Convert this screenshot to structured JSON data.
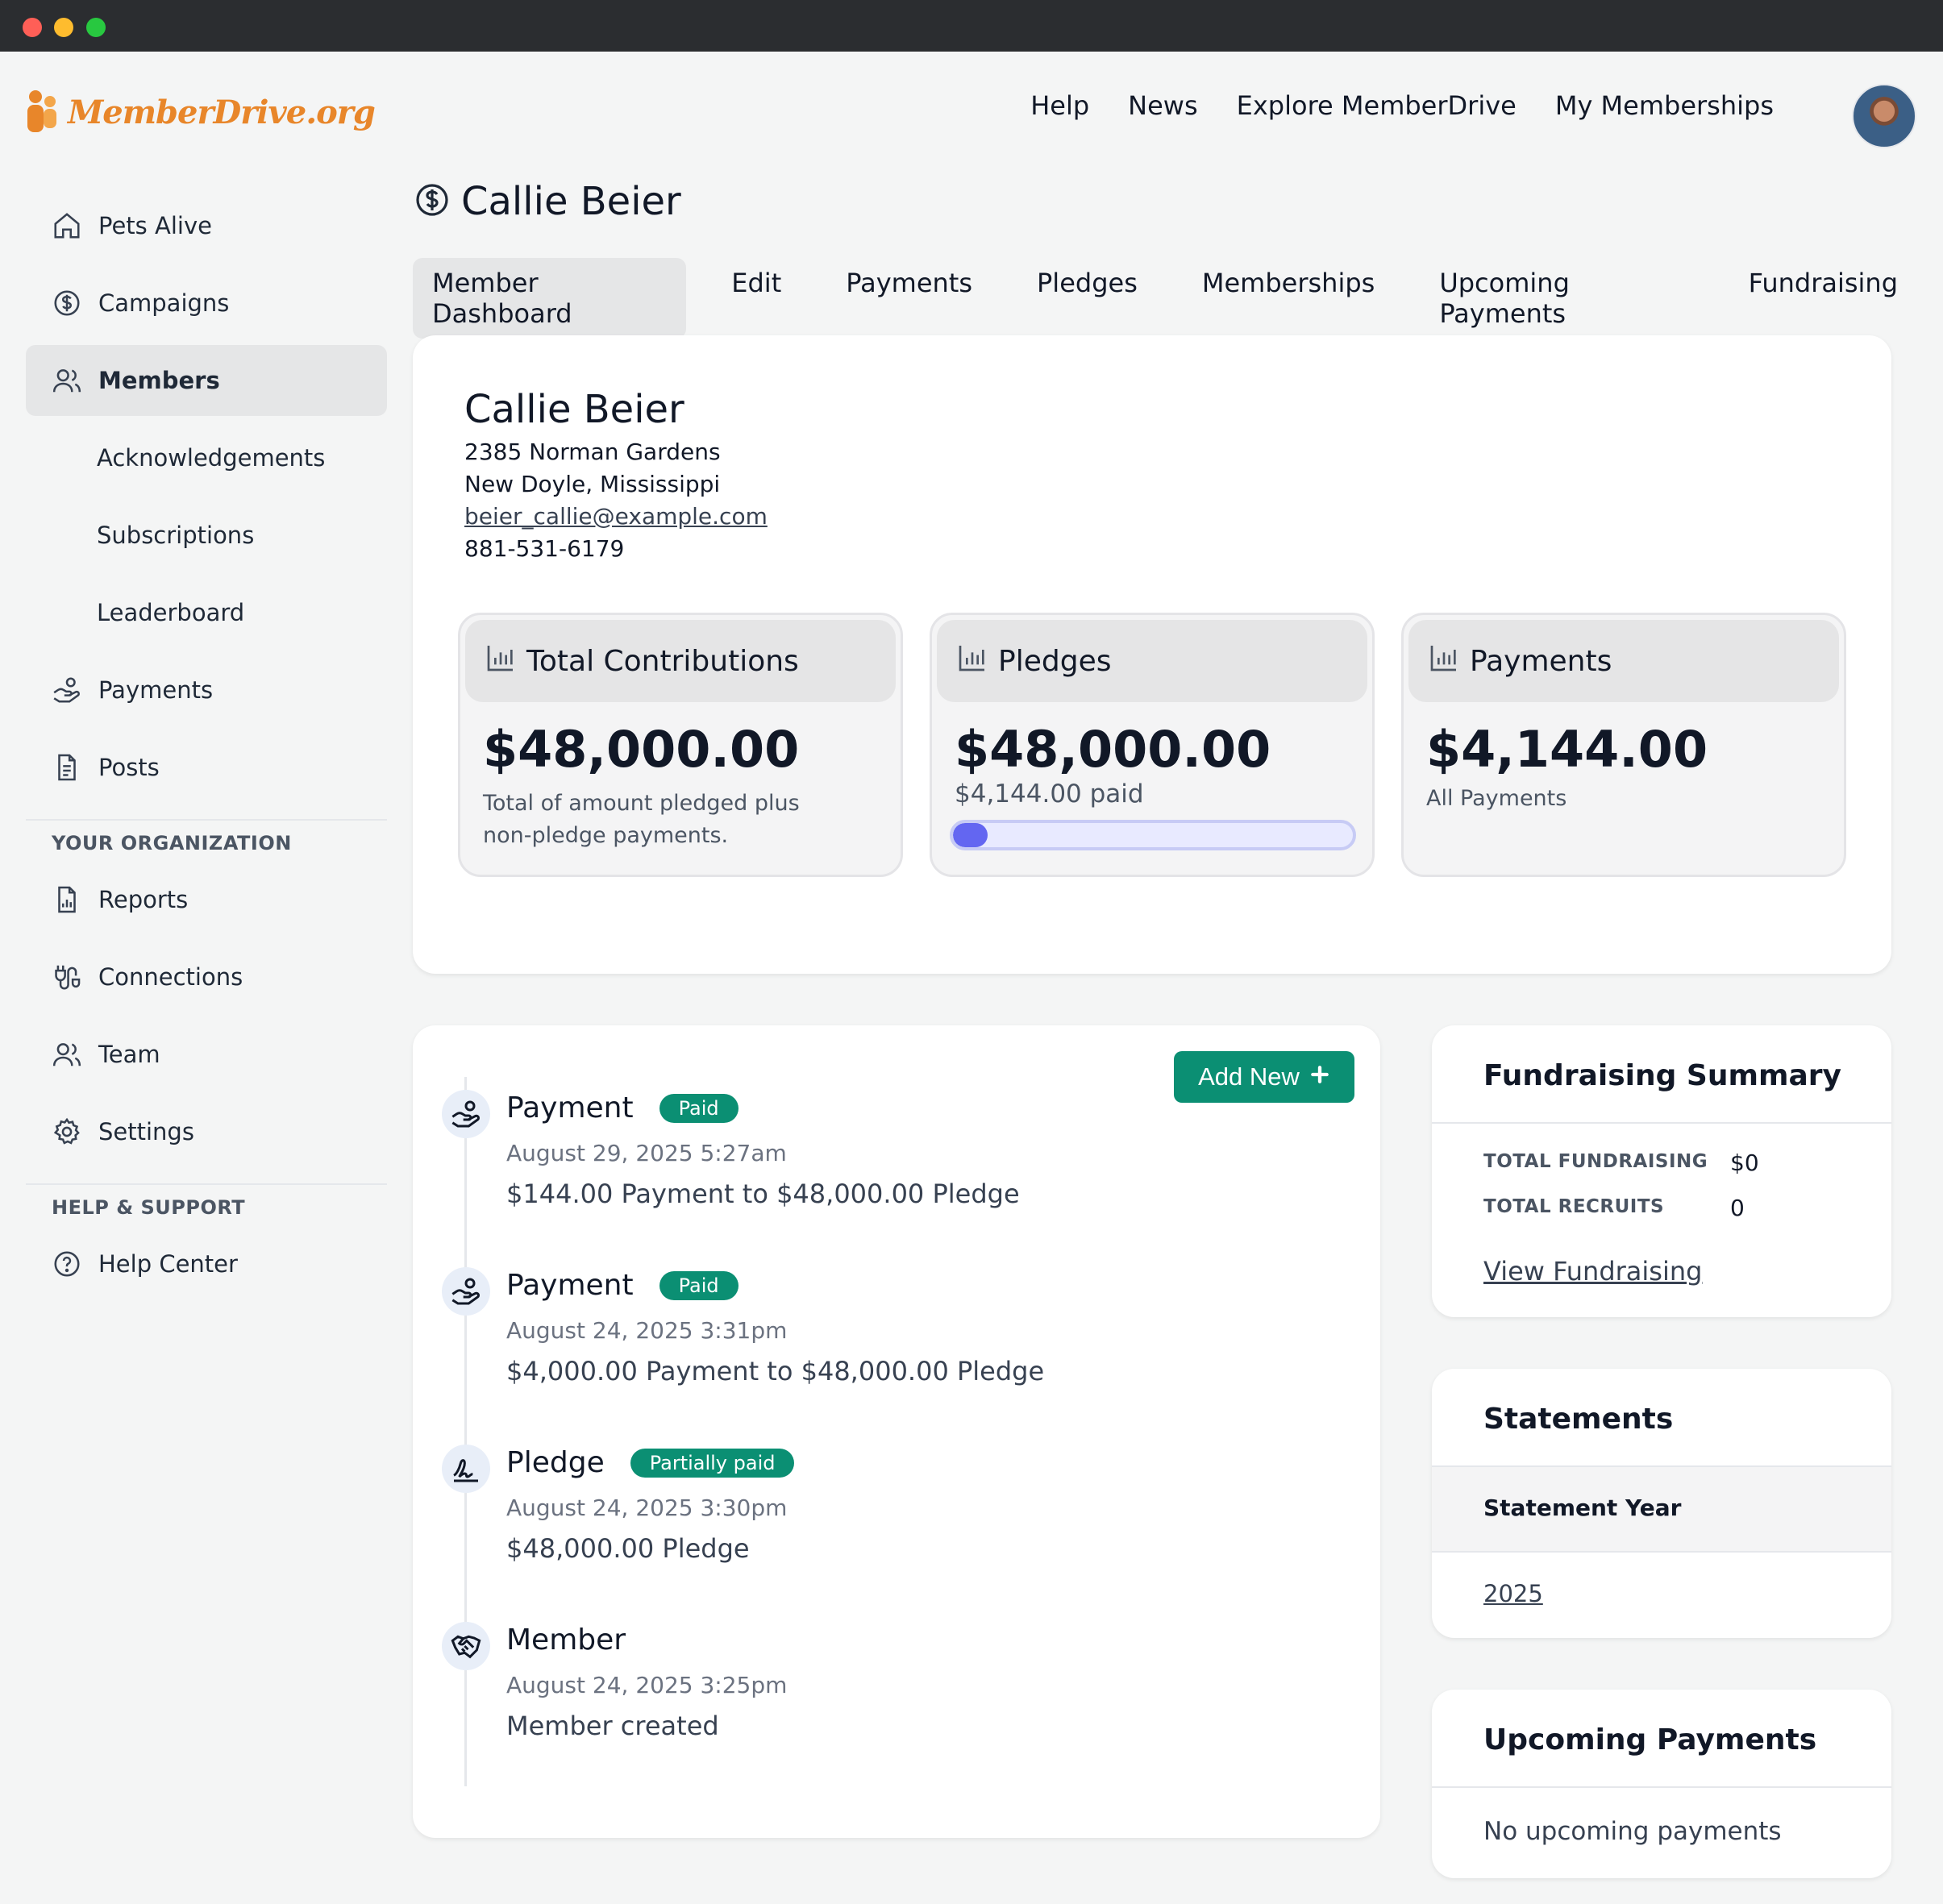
{
  "app": {
    "logo_text": "MemberDrive.org"
  },
  "topnav": [
    "Help",
    "News",
    "Explore MemberDrive",
    "My Memberships"
  ],
  "sidebar": {
    "items": [
      {
        "label": "Pets Alive",
        "icon": "home-icon"
      },
      {
        "label": "Campaigns",
        "icon": "dollar-circle-icon"
      },
      {
        "label": "Members",
        "icon": "users-icon",
        "active": true
      },
      {
        "label": "Acknowledgements",
        "sub": true
      },
      {
        "label": "Subscriptions",
        "sub": true
      },
      {
        "label": "Leaderboard",
        "sub": true
      },
      {
        "label": "Payments",
        "icon": "hand-coins-icon"
      },
      {
        "label": "Posts",
        "icon": "document-icon"
      }
    ],
    "org_heading": "YOUR ORGANIZATION",
    "org_items": [
      {
        "label": "Reports",
        "icon": "report-icon"
      },
      {
        "label": "Connections",
        "icon": "plug-icon"
      },
      {
        "label": "Team",
        "icon": "users-icon"
      },
      {
        "label": "Settings",
        "icon": "gear-icon"
      }
    ],
    "help_heading": "HELP & SUPPORT",
    "help_items": [
      {
        "label": "Help Center",
        "icon": "question-circle-icon"
      }
    ]
  },
  "page": {
    "title": "Callie Beier",
    "tabs": [
      "Member Dashboard",
      "Edit",
      "Payments",
      "Pledges",
      "Memberships",
      "Upcoming Payments",
      "Fundraising"
    ],
    "active_tab": "Member Dashboard"
  },
  "member": {
    "name": "Callie Beier",
    "address1": "2385 Norman Gardens",
    "address2": "New Doyle, Mississippi",
    "email": "beier_callie@example.com",
    "phone": "881-531-6179"
  },
  "stats": {
    "contributions": {
      "label": "Total Contributions",
      "value": "$48,000.00",
      "desc": "Total of amount pledged plus non-pledge payments."
    },
    "pledges": {
      "label": "Pledges",
      "value": "$48,000.00",
      "sub": "$4,144.00 paid",
      "progress": 0.0863
    },
    "payments": {
      "label": "Payments",
      "value": "$4,144.00",
      "sub": "All Payments"
    }
  },
  "timeline": {
    "add_new_label": "Add New",
    "items": [
      {
        "type": "Payment",
        "badge": "Paid",
        "date": "August 29, 2025 5:27am",
        "desc": "$144.00 Payment to $48,000.00 Pledge",
        "icon": "hand-coins-icon"
      },
      {
        "type": "Payment",
        "badge": "Paid",
        "date": "August 24, 2025 3:31pm",
        "desc": "$4,000.00 Payment to $48,000.00 Pledge",
        "icon": "hand-coins-icon"
      },
      {
        "type": "Pledge",
        "badge": "Partially paid",
        "date": "August 24, 2025 3:30pm",
        "desc": "$48,000.00 Pledge",
        "icon": "signature-icon"
      },
      {
        "type": "Member",
        "badge": "",
        "date": "August 24, 2025 3:25pm",
        "desc": "Member created",
        "icon": "handshake-icon"
      }
    ]
  },
  "fundraising_summary": {
    "title": "Fundraising Summary",
    "total_fundraising_label": "TOTAL FUNDRAISING",
    "total_fundraising_value": "$0",
    "total_recruits_label": "TOTAL RECRUITS",
    "total_recruits_value": "0",
    "link": "View Fundraising"
  },
  "statements": {
    "title": "Statements",
    "column": "Statement Year",
    "years": [
      "2025"
    ]
  },
  "upcoming": {
    "title": "Upcoming Payments",
    "empty": "No upcoming payments"
  },
  "colors": {
    "accent_green": "#0b8f73",
    "progress": "#6366f1",
    "logo_orange": "#e8862a"
  }
}
